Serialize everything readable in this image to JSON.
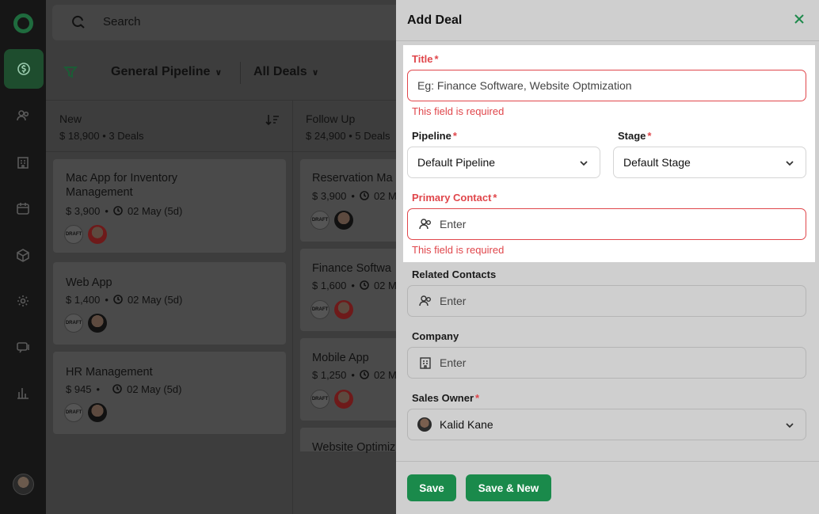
{
  "search": {
    "placeholder": "Search"
  },
  "pipeline_bar": {
    "pipeline": "General Pipeline",
    "filter": "All Deals"
  },
  "columns": [
    {
      "title": "New",
      "summary": "$ 18,900  •  3 Deals"
    },
    {
      "title": "Follow Up",
      "summary": "$ 24,900  •  5 Deals"
    }
  ],
  "new_cards": [
    {
      "title": "Mac App for Inventory Management",
      "amount": "$ 3,900",
      "date": "02 May (5d)"
    },
    {
      "title": "Web App",
      "amount": "$ 1,400",
      "date": "02 May (5d)"
    },
    {
      "title": "HR Management",
      "amount": "$ 945",
      "date": "02 May (5d)"
    }
  ],
  "followup_cards": [
    {
      "title": "Reservation Ma",
      "amount": "$ 3,900",
      "date": "02 M"
    },
    {
      "title": "Finance Softwa",
      "amount": "$ 1,600",
      "date": "02 M"
    },
    {
      "title": "Mobile App",
      "amount": "$ 1,250",
      "date": "02 M"
    },
    {
      "title": "Website Optimiz"
    }
  ],
  "badge_text": "DRAFT",
  "drawer": {
    "title": "Add Deal",
    "title_label": "Title",
    "title_placeholder": "Eg: Finance Software, Website Optmization",
    "required_error": "This field is required",
    "pipeline_label": "Pipeline",
    "pipeline_value": "Default Pipeline",
    "stage_label": "Stage",
    "stage_value": "Default Stage",
    "primary_contact_label": "Primary Contact",
    "enter_placeholder": "Enter",
    "related_contacts_label": "Related Contacts",
    "company_label": "Company",
    "sales_owner_label": "Sales Owner",
    "sales_owner_value": "Kalid Kane",
    "required_mark": "*",
    "save": "Save",
    "save_new": "Save & New"
  },
  "colors": {
    "accent": "#1a8a4b",
    "error": "#e0464b"
  }
}
